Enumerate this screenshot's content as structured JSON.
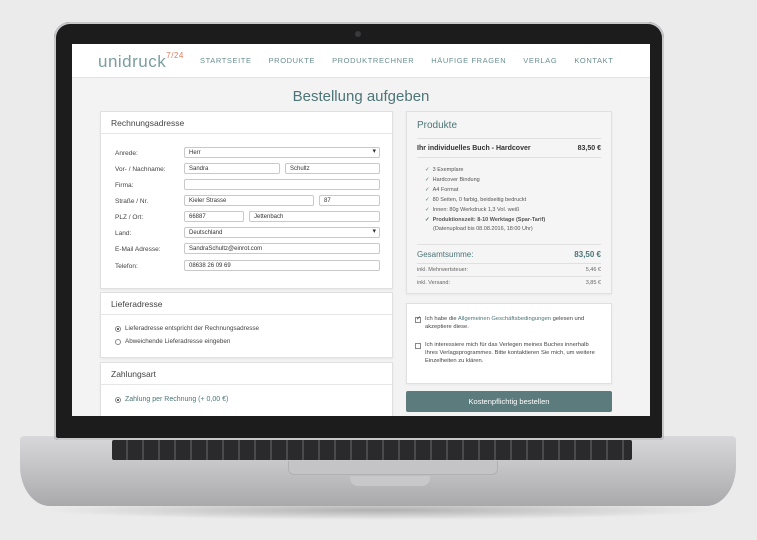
{
  "nav": {
    "logo_text": "unidruck",
    "logo_super": "7/24",
    "items": [
      "STARTSEITE",
      "PRODUKTE",
      "PRODUKTRECHNER",
      "HÄUFIGE FRAGEN",
      "VERLAG",
      "KONTAKT"
    ]
  },
  "page_title": "Bestellung aufgeben",
  "billing": {
    "title": "Rechnungsadresse",
    "labels": {
      "salutation": "Anrede:",
      "name": "Vor- / Nachname:",
      "company": "Firma:",
      "street": "Straße / Nr.",
      "zip_city": "PLZ / Ort:",
      "country": "Land:",
      "email": "E-Mail Adresse:",
      "phone": "Telefon:"
    },
    "values": {
      "salutation": "Herr",
      "first_name": "Sandra",
      "last_name": "Schultz",
      "company": "",
      "street": "Kieler Strasse",
      "house_no": "87",
      "zip": "66887",
      "city": "Jettenbach",
      "country": "Deutschland",
      "email": "SandraSchultz@einrot.com",
      "phone": "08638 26 09 69"
    }
  },
  "delivery": {
    "title": "Lieferadresse",
    "option_same": "Lieferadresse entspricht der Rechnungsadresse",
    "option_other": "Abweichende Lieferadresse eingeben"
  },
  "payment": {
    "title": "Zahlungsart",
    "option_invoice": "Zahlung per Rechnung (+ 0,00 €)"
  },
  "products": {
    "title": "Produkte",
    "item_name": "Ihr individuelles Buch - Hardcover",
    "item_price": "83,50 €",
    "features": [
      "3 Exemplare",
      "Hardcover Bindung",
      "A4 Format",
      "80 Seiten, 0 farbig, beidseitig bedruckt",
      "Innen: 80g Werkdruck 1,3 Vol. weiß",
      "Produktionszeit: 8-10 Werktage (Spar-Tarif)"
    ],
    "upload_note": "(Datenupload bis 08.08.2016, 18:00 Uhr)",
    "total_label": "Gesamtsumme:",
    "total_value": "83,50 €",
    "vat_label": "inkl. Mehrwertsteuer:",
    "vat_value": "5,46 €",
    "shipping_label": "inkl. Versand:",
    "shipping_value": "3,85 €"
  },
  "agreements": {
    "terms_pre": "Ich habe die ",
    "terms_link": "Allgemeinen Geschäftsbedingungen",
    "terms_post": " gelesen und akzeptiere diese.",
    "publish": "Ich interessiere mich für das Verlegen meines Buches innerhalb Ihres Verlagsprogrammes. Bitte kontaktieren Sie mich, um weitere Einzelheiten zu klären."
  },
  "order_button": "Kostenpflichtig bestellen"
}
